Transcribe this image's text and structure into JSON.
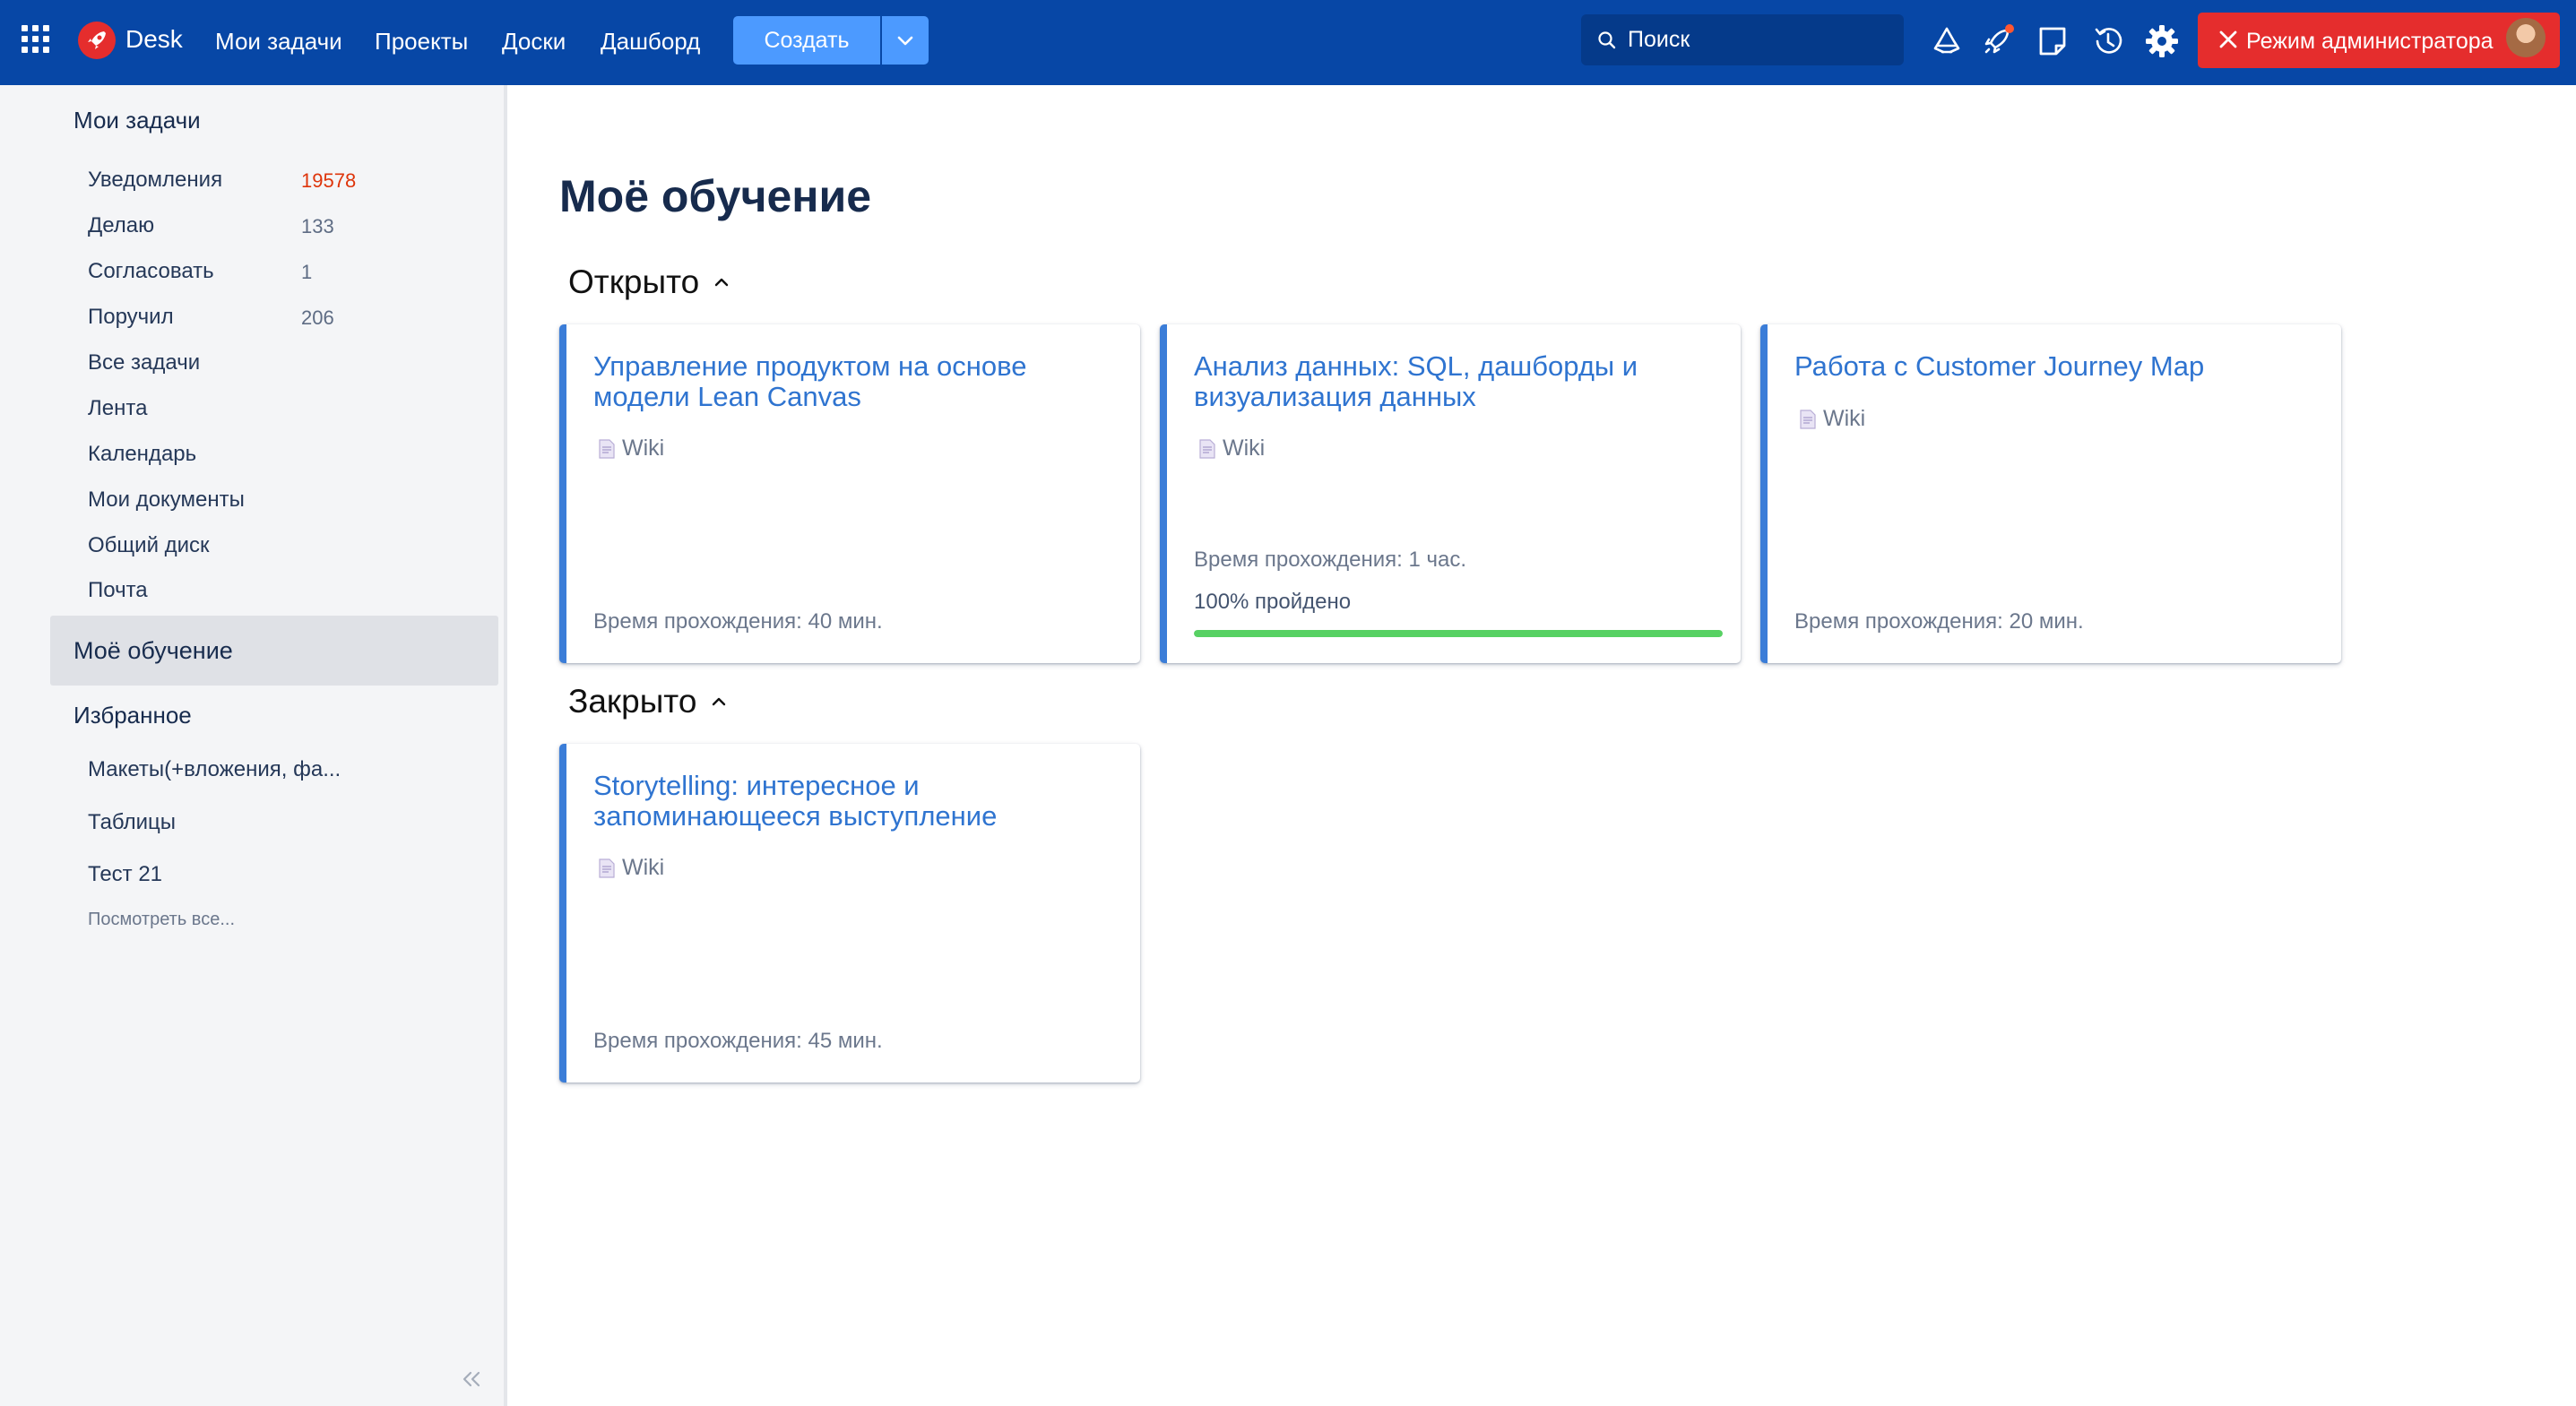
{
  "topbar": {
    "brand": "Desk",
    "nav": [
      "Мои задачи",
      "Проекты",
      "Доски",
      "Дашборд"
    ],
    "create_label": "Создать",
    "search_placeholder": "Поиск",
    "admin_label": "Режим администратора",
    "colors": {
      "bar": "#0747a6",
      "accent": "#4c9aff",
      "admin": "#e52d2d",
      "notify_dot": "#ff5630"
    }
  },
  "sidebar": {
    "tasks_title": "Мои задачи",
    "items": [
      {
        "label": "Уведомления",
        "count": "19578"
      },
      {
        "label": "Делаю",
        "count": "133"
      },
      {
        "label": "Согласовать",
        "count": "1"
      },
      {
        "label": "Поручил",
        "count": "206"
      },
      {
        "label": "Все задачи"
      },
      {
        "label": "Лента"
      },
      {
        "label": "Календарь"
      },
      {
        "label": "Мои документы"
      },
      {
        "label": "Общий диск"
      },
      {
        "label": "Почта"
      }
    ],
    "active_item": "Моё обучение",
    "favorites_title": "Избранное",
    "favorites": [
      "Макеты(+вложения, фа...",
      "Таблицы",
      "Тест 21"
    ],
    "view_all": "Посмотреть все..."
  },
  "main": {
    "title": "Моё обучение",
    "open_title": "Открыто",
    "closed_title": "Закрыто",
    "open_cards": [
      {
        "title": "Управление продуктом на основе модели Lean Canvas",
        "type": "Wiki",
        "time": "Время прохождения: 40 мин."
      },
      {
        "title": "Анализ данных: SQL, дашборды и визуализация данных",
        "type": "Wiki",
        "time": "Время прохождения: 1 час.",
        "progress_label": "100% пройдено",
        "progress": 1.0
      },
      {
        "title": "Работа с Customer Journey Map",
        "type": "Wiki",
        "time": "Время прохождения: 20 мин."
      }
    ],
    "closed_cards": [
      {
        "title": "Storytelling: интересное и запоминающееся выступление",
        "type": "Wiki",
        "time": "Время прохождения: 45 мин."
      }
    ]
  }
}
